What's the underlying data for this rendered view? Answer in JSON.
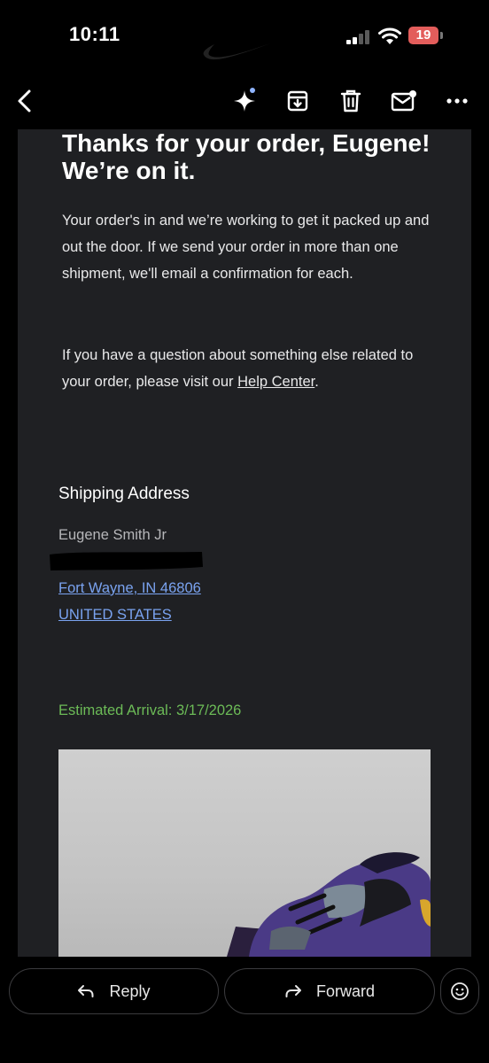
{
  "status_bar": {
    "time": "10:11",
    "battery_level": "19",
    "icons": [
      "signal-icon",
      "wifi-icon",
      "battery-icon"
    ],
    "battery_color": "#e35d5b"
  },
  "toolbar": {
    "icons": [
      "back-icon",
      "sparkle-icon",
      "archive-icon",
      "trash-icon",
      "mark-unread-icon",
      "more-icon"
    ]
  },
  "email": {
    "heading": "Thanks for your order, Eugene! We’re on it.",
    "paragraph1": "Your order's in and we’re working to get it packed up and out the door. If we send your order in more than one shipment, we'll email a confirmation for each.",
    "paragraph2_prefix": "If you have a question about something else related to your order, please visit our ",
    "help_link": "Help Center",
    "paragraph2_suffix": ".",
    "shipping": {
      "title": "Shipping Address",
      "name": "Eugene Smith Jr",
      "city_line": "Fort Wayne, IN 46806",
      "country": "UNITED STATES"
    },
    "estimated_arrival": "Estimated Arrival: 3/17/2026",
    "colors": {
      "background": "#1f2023",
      "link": "#7aa3f0",
      "eta": "#6cbb57"
    }
  },
  "actions": {
    "reply_label": "Reply",
    "forward_label": "Forward",
    "emoji_icon": "emoji-icon"
  }
}
